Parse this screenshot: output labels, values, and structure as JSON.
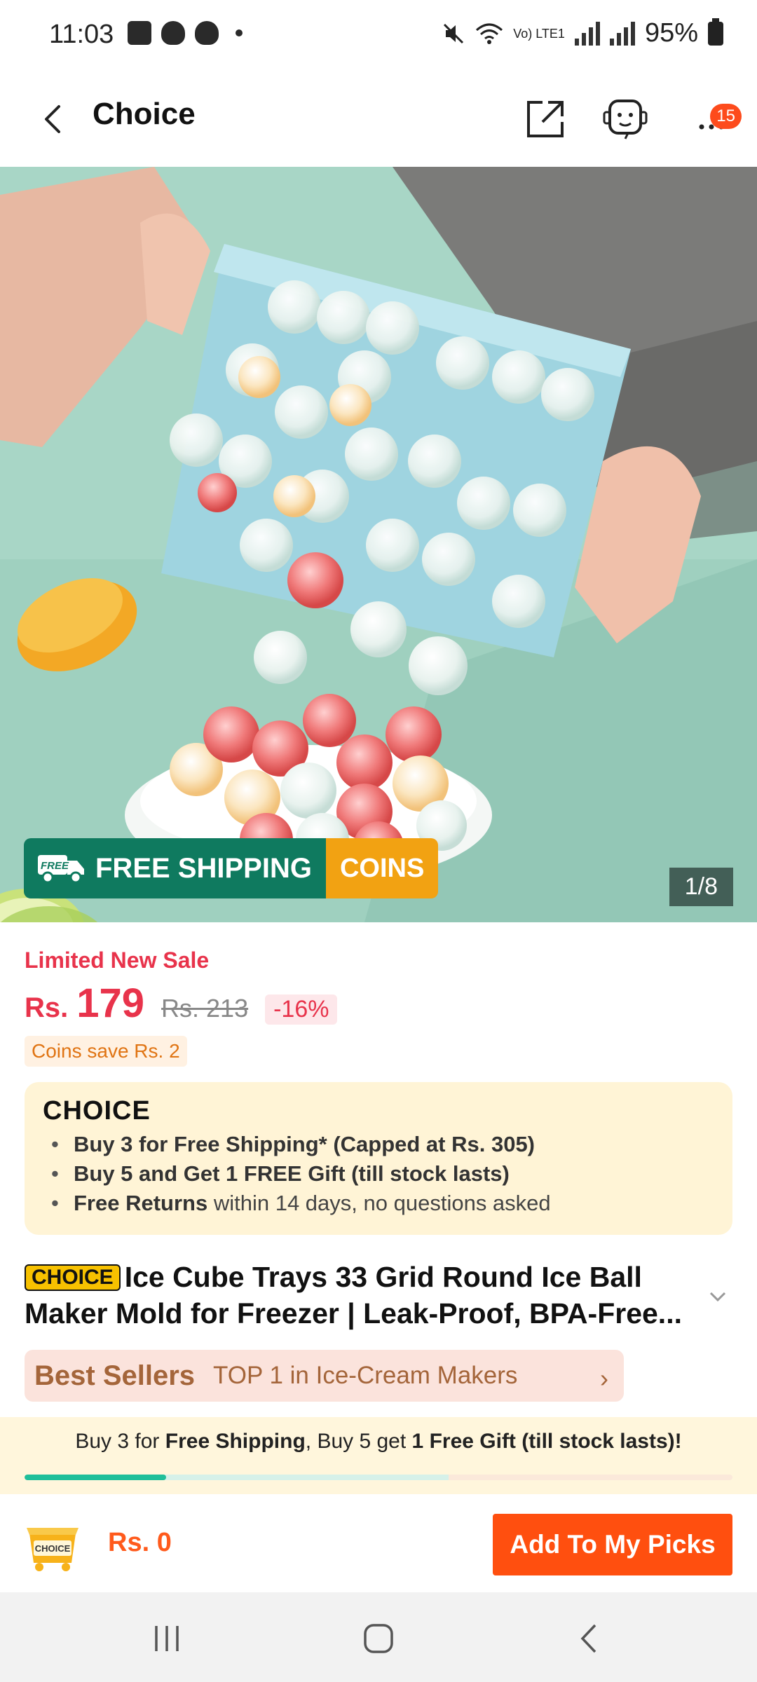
{
  "status_bar": {
    "time": "11:03",
    "battery": "95%",
    "network": "Vo) LTE1"
  },
  "header": {
    "title": "Choice",
    "badge_count": "15"
  },
  "gallery": {
    "counter": "1/8",
    "shipping_label": "FREE SHIPPING",
    "coins_label": "COINS",
    "truck_tag": "FREE"
  },
  "pricing": {
    "sale_label": "Limited New Sale",
    "currency": "Rs.",
    "price": "179",
    "old_price": "Rs. 213",
    "discount": "-16%",
    "coins_save": "Coins save Rs. 2"
  },
  "choice_box": {
    "logo": "CHOICE",
    "benefit_1": "Buy 3 for  Free Shipping* (Capped at Rs. 305)",
    "benefit_2": "Buy 5 and Get 1 FREE Gift (till stock lasts)",
    "benefit_3_strong": "Free Returns",
    "benefit_3_rest": " within 14 days, no questions asked"
  },
  "product": {
    "chip": "CHOICE",
    "title": "Ice Cube Trays 33 Grid Round Ice Ball Maker Mold for Freezer | Leak-Proof, BPA-Free..."
  },
  "bestseller": {
    "label": "Best Sellers",
    "text": "TOP 1 in Ice-Cream Makers"
  },
  "promo": {
    "p1": "Buy 3 for ",
    "p2": "Free Shipping",
    "p3": ", Buy 5 get ",
    "p4": "1 Free Gift (till stock lasts)!",
    "progress": 0.2
  },
  "bottom_bar": {
    "cart_label": "CHOICE",
    "total": "Rs. 0",
    "add_button": "Add To My Picks"
  },
  "colors": {
    "accent": "#ff4f0f",
    "price": "#e8334b",
    "shipping_green": "#0f7a5f",
    "coins_orange": "#f2a212"
  }
}
